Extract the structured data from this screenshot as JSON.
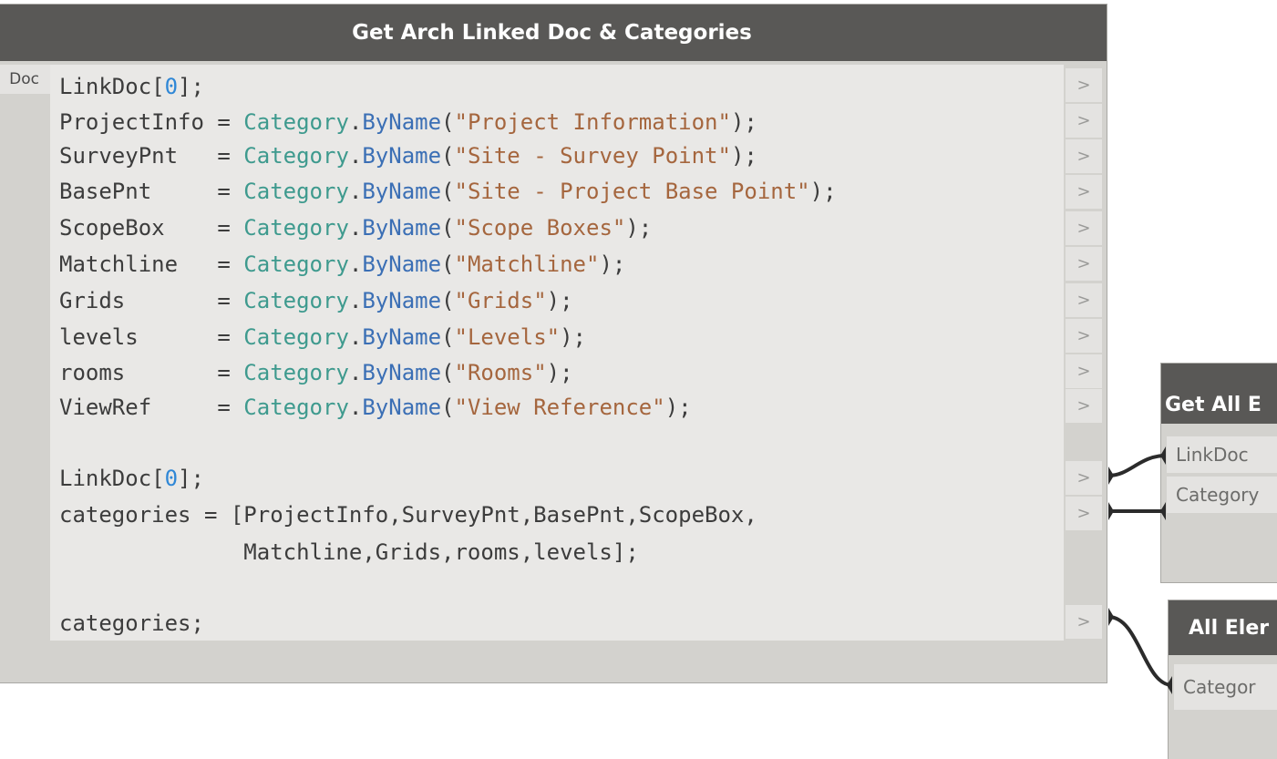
{
  "main_node": {
    "title": "Get Arch Linked Doc & Categories",
    "input_port_label": "Doc",
    "code_lines": [
      [
        {
          "t": "LinkDoc[",
          "c": "var"
        },
        {
          "t": "0",
          "c": "num"
        },
        {
          "t": "];",
          "c": "var"
        }
      ],
      [
        {
          "t": "ProjectInfo = ",
          "c": "var"
        },
        {
          "t": "Category",
          "c": "cls"
        },
        {
          "t": ".",
          "c": "var"
        },
        {
          "t": "ByName",
          "c": "mth"
        },
        {
          "t": "(",
          "c": "var"
        },
        {
          "t": "\"Project Information\"",
          "c": "str"
        },
        {
          "t": ");",
          "c": "var"
        }
      ],
      [
        {
          "t": "SurveyPnt   = ",
          "c": "var"
        },
        {
          "t": "Category",
          "c": "cls"
        },
        {
          "t": ".",
          "c": "var"
        },
        {
          "t": "ByName",
          "c": "mth"
        },
        {
          "t": "(",
          "c": "var"
        },
        {
          "t": "\"Site - Survey Point\"",
          "c": "str"
        },
        {
          "t": ");",
          "c": "var"
        }
      ],
      [
        {
          "t": "BasePnt     = ",
          "c": "var"
        },
        {
          "t": "Category",
          "c": "cls"
        },
        {
          "t": ".",
          "c": "var"
        },
        {
          "t": "ByName",
          "c": "mth"
        },
        {
          "t": "(",
          "c": "var"
        },
        {
          "t": "\"Site - Project Base Point\"",
          "c": "str"
        },
        {
          "t": ");",
          "c": "var"
        }
      ],
      [
        {
          "t": "ScopeBox    = ",
          "c": "var"
        },
        {
          "t": "Category",
          "c": "cls"
        },
        {
          "t": ".",
          "c": "var"
        },
        {
          "t": "ByName",
          "c": "mth"
        },
        {
          "t": "(",
          "c": "var"
        },
        {
          "t": "\"Scope Boxes\"",
          "c": "str"
        },
        {
          "t": ");",
          "c": "var"
        }
      ],
      [
        {
          "t": "Matchline   = ",
          "c": "var"
        },
        {
          "t": "Category",
          "c": "cls"
        },
        {
          "t": ".",
          "c": "var"
        },
        {
          "t": "ByName",
          "c": "mth"
        },
        {
          "t": "(",
          "c": "var"
        },
        {
          "t": "\"Matchline\"",
          "c": "str"
        },
        {
          "t": ");",
          "c": "var"
        }
      ],
      [
        {
          "t": "Grids       = ",
          "c": "var"
        },
        {
          "t": "Category",
          "c": "cls"
        },
        {
          "t": ".",
          "c": "var"
        },
        {
          "t": "ByName",
          "c": "mth"
        },
        {
          "t": "(",
          "c": "var"
        },
        {
          "t": "\"Grids\"",
          "c": "str"
        },
        {
          "t": ");",
          "c": "var"
        }
      ],
      [
        {
          "t": "levels      = ",
          "c": "var"
        },
        {
          "t": "Category",
          "c": "cls"
        },
        {
          "t": ".",
          "c": "var"
        },
        {
          "t": "ByName",
          "c": "mth"
        },
        {
          "t": "(",
          "c": "var"
        },
        {
          "t": "\"Levels\"",
          "c": "str"
        },
        {
          "t": ");",
          "c": "var"
        }
      ],
      [
        {
          "t": "rooms       = ",
          "c": "var"
        },
        {
          "t": "Category",
          "c": "cls"
        },
        {
          "t": ".",
          "c": "var"
        },
        {
          "t": "ByName",
          "c": "mth"
        },
        {
          "t": "(",
          "c": "var"
        },
        {
          "t": "\"Rooms\"",
          "c": "str"
        },
        {
          "t": ");",
          "c": "var"
        }
      ],
      [
        {
          "t": "ViewRef     = ",
          "c": "var"
        },
        {
          "t": "Category",
          "c": "cls"
        },
        {
          "t": ".",
          "c": "var"
        },
        {
          "t": "ByName",
          "c": "mth"
        },
        {
          "t": "(",
          "c": "var"
        },
        {
          "t": "\"View Reference\"",
          "c": "str"
        },
        {
          "t": ");",
          "c": "var"
        }
      ],
      [],
      [
        {
          "t": "LinkDoc[",
          "c": "var"
        },
        {
          "t": "0",
          "c": "num"
        },
        {
          "t": "];",
          "c": "var"
        }
      ],
      [
        {
          "t": "categories = [ProjectInfo,SurveyPnt,BasePnt,ScopeBox,",
          "c": "var"
        }
      ],
      [
        {
          "t": "              Matchline,Grids,rooms,levels];",
          "c": "var"
        }
      ],
      [],
      [
        {
          "t": "categories;",
          "c": "var"
        }
      ]
    ],
    "output_port_symbol": ">"
  },
  "right_nodes": [
    {
      "title": "Get All E",
      "ports": [
        "LinkDoc",
        "Category"
      ]
    },
    {
      "title": "All Eler",
      "ports": [
        "Categor"
      ]
    }
  ],
  "colors": {
    "title_bar": "#595856",
    "node_body": "#d3d2ce",
    "code_bg": "#e9e8e6",
    "class_token": "#3e9a8e",
    "method_token": "#3b6fb5",
    "string_token": "#a5663e",
    "number_token": "#2f87d6",
    "wire": "#2b2b2b"
  }
}
